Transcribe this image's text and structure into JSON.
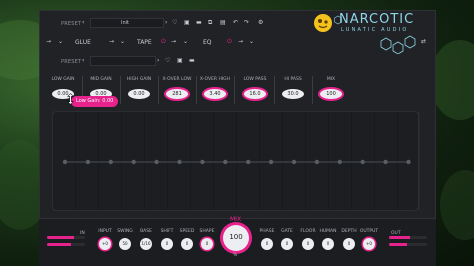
{
  "top_bar": {
    "preset_label": "PRESET",
    "init_label": "Init"
  },
  "brand": {
    "name": "NARCOTIC",
    "subtitle": "LUNATIC AUDIO"
  },
  "module_row": {
    "glue_label": "GLUE",
    "tape_label": "TAPE",
    "eq_label": "EQ"
  },
  "lower_preset": {
    "preset_label": "PRESET"
  },
  "knobs": [
    {
      "label": "LOW GAIN",
      "value": "0.00"
    },
    {
      "label": "MID GAIN",
      "value": "0.00"
    },
    {
      "label": "HIGH GAIN",
      "value": "0.00"
    },
    {
      "label": "X-OVER LOW",
      "value": "281"
    },
    {
      "label": "X-OVER HIGH",
      "value": "3.40"
    },
    {
      "label": "LOW PASS",
      "value": "16.0"
    },
    {
      "label": "HI PASS",
      "value": "30.0"
    },
    {
      "label": "MIX",
      "value": "100"
    }
  ],
  "tooltip": {
    "text": "Low Gain: 0.00"
  },
  "bottom": {
    "in_label": "IN",
    "out_label": "OUT",
    "mix_label": "MIX",
    "mix_value": "100",
    "mix_percent": "%",
    "knobs": [
      {
        "label": "INPUT",
        "value": "+0"
      },
      {
        "label": "SWING",
        "value": "50"
      },
      {
        "label": "BASE",
        "value": "1/16"
      },
      {
        "label": "SHIFT",
        "value": "0"
      },
      {
        "label": "SPEED",
        "value": "0"
      },
      {
        "label": "SHAPE",
        "value": "0"
      },
      {
        "label": "PHASE",
        "value": "0"
      },
      {
        "label": "GATE",
        "value": "0"
      },
      {
        "label": "FLOOR",
        "value": "0"
      },
      {
        "label": "HUMAN",
        "value": "0"
      },
      {
        "label": "DEPTH",
        "value": "0"
      },
      {
        "label": "OUTPUT",
        "value": "+0"
      }
    ]
  },
  "colors": {
    "accent": "#e8228c",
    "brand": "#8fd6e8",
    "panel": "#202226"
  }
}
